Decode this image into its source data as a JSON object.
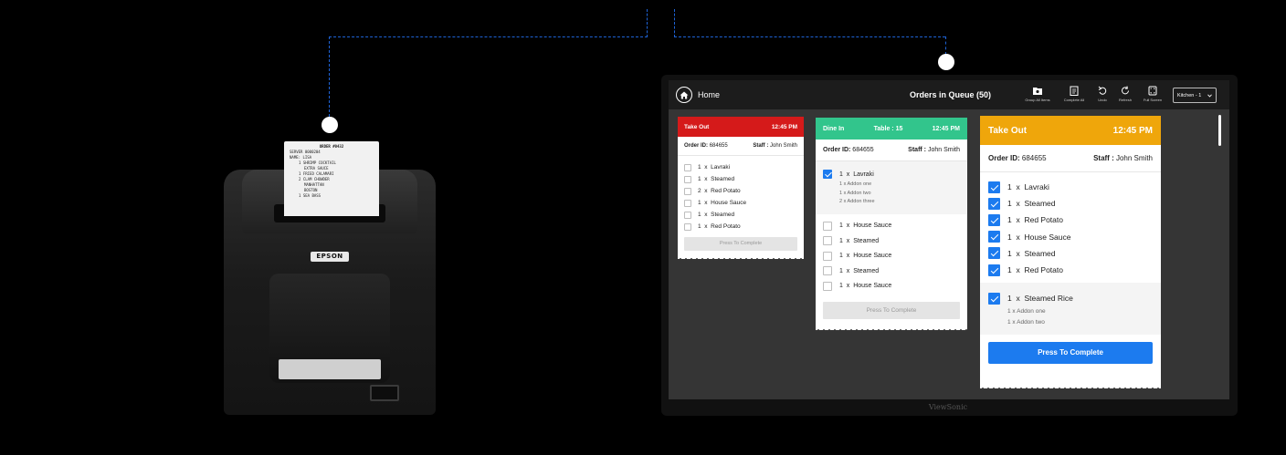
{
  "receipt": {
    "title": "ORDER #0432",
    "lines": [
      "SERVER 0000204",
      "NAME: LISA",
      "1 SHRIMP COCKTAIL",
      "EXTRA SAUCE",
      "1 FRIED CALAMARI",
      "2 CLAM CHOWDER",
      "MANHATTAN",
      "BOSTON",
      "1 SEA BASS"
    ]
  },
  "printer": {
    "brand": "EPSON"
  },
  "monitor": {
    "brand": "ViewSonic"
  },
  "topbar": {
    "home_label": "Home",
    "queue_title": "Orders in Queue (50)",
    "tools": {
      "group": "Group All Items",
      "complete_all": "Complete All",
      "undo": "Undo",
      "refresh": "Refresh",
      "full_screen": "Full Screen"
    },
    "station": "Kitchen - 1"
  },
  "tickets": [
    {
      "type": "Take Out",
      "time": "12:45 PM",
      "color": "#d51a1a",
      "order_label": "Order ID:",
      "order_id": "684655",
      "staff_label": "Staff :",
      "staff": "John Smith",
      "items": [
        {
          "qty": "1",
          "x": "x",
          "name": "Lavraki",
          "checked": false
        },
        {
          "qty": "1",
          "x": "x",
          "name": "Steamed",
          "checked": false
        },
        {
          "qty": "2",
          "x": "x",
          "name": "Red Potato",
          "checked": false
        },
        {
          "qty": "1",
          "x": "x",
          "name": "House Sauce",
          "checked": false
        },
        {
          "qty": "1",
          "x": "x",
          "name": "Steamed",
          "checked": false
        },
        {
          "qty": "1",
          "x": "x",
          "name": "Red Potato",
          "checked": false
        }
      ],
      "button": "Press To Complete"
    },
    {
      "type": "Dine In",
      "table": "Table : 15",
      "time": "12:45 PM",
      "color": "#32c58c",
      "order_label": "Order ID:",
      "order_id": "684655",
      "staff_label": "Staff :",
      "staff": "John Smith",
      "group_item": {
        "qty": "1",
        "x": "x",
        "name": "Lavraki",
        "checked": true,
        "addons": [
          "1  x  Addon one",
          "1  x  Addon two",
          "2  x  Addon three"
        ]
      },
      "items": [
        {
          "qty": "1",
          "x": "x",
          "name": "House Sauce",
          "checked": false
        },
        {
          "qty": "1",
          "x": "x",
          "name": "Steamed",
          "checked": false
        },
        {
          "qty": "1",
          "x": "x",
          "name": "House Sauce",
          "checked": false
        },
        {
          "qty": "1",
          "x": "x",
          "name": "Steamed",
          "checked": false
        },
        {
          "qty": "1",
          "x": "x",
          "name": "House Sauce",
          "checked": false
        }
      ],
      "button": "Press To Complete"
    },
    {
      "type": "Take Out",
      "time": "12:45 PM",
      "color": "#efa60b",
      "order_label": "Order ID:",
      "order_id": "684655",
      "staff_label": "Staff :",
      "staff": "John Smith",
      "items": [
        {
          "qty": "1",
          "x": "x",
          "name": "Lavraki",
          "checked": true
        },
        {
          "qty": "1",
          "x": "x",
          "name": "Steamed",
          "checked": true
        },
        {
          "qty": "1",
          "x": "x",
          "name": "Red Potato",
          "checked": true
        },
        {
          "qty": "1",
          "x": "x",
          "name": "House Sauce",
          "checked": true
        },
        {
          "qty": "1",
          "x": "x",
          "name": "Steamed",
          "checked": true
        },
        {
          "qty": "1",
          "x": "x",
          "name": "Red Potato",
          "checked": true
        }
      ],
      "group_item": {
        "qty": "1",
        "x": "x",
        "name": "Steamed Rice",
        "checked": true,
        "addons": [
          "1  x  Addon one",
          "1  x  Addon two"
        ]
      },
      "button": "Press To Complete"
    }
  ]
}
